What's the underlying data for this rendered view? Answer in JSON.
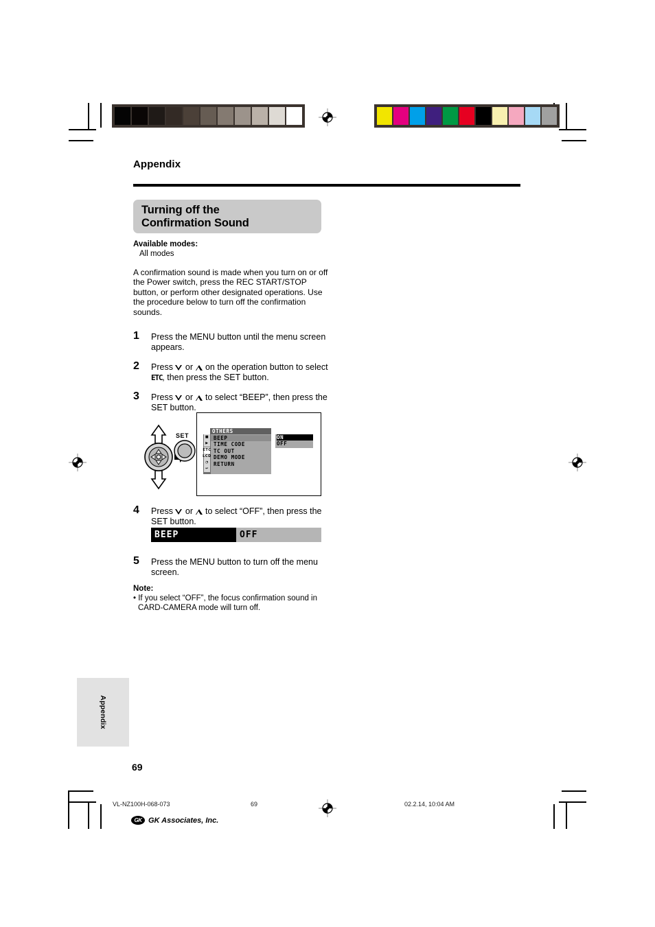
{
  "page": {
    "running_head": "Appendix",
    "heading_line1": "Turning off the",
    "heading_line2": "Confirmation Sound",
    "available_label": "Available modes:",
    "available_value": "All modes",
    "intro": "A confirmation sound is made when you turn on or off the Power switch, press the REC START/STOP button, or perform other designated operations. Use the procedure below to turn off the confirmation sounds.",
    "side_tab_label": "Appendix",
    "page_number": "69"
  },
  "steps": [
    {
      "number": "1",
      "text_parts": [
        "Press the MENU button until the menu screen appears."
      ]
    },
    {
      "number": "2",
      "pre": "Press ",
      "mid": " or ",
      "post": " on the operation button to select ",
      "osd_token": "ETC",
      "tail": ", then press the SET button."
    },
    {
      "number": "3",
      "pre": "Press ",
      "mid": " or ",
      "post": " to select “BEEP”, then press the SET button."
    },
    {
      "number": "4",
      "pre": "Press ",
      "mid": " or ",
      "post": " to select “OFF”, then press the SET button."
    },
    {
      "number": "5",
      "text_parts": [
        "Press the MENU button to turn off the menu screen."
      ]
    }
  ],
  "figure_operation_button": {
    "set_label": "SET",
    "up_arrow": "up-arrow",
    "down_arrow": "down-arrow",
    "left_arrow": "left-arrow",
    "right_arrow": "right-arrow"
  },
  "osd_menu": {
    "title": "OTHERS",
    "icons": [
      {
        "name": "camera-mode-icon",
        "glyph": "■",
        "selected": false
      },
      {
        "name": "playback-mode-icon",
        "glyph": "▶",
        "selected": false
      },
      {
        "name": "etc-mode-icon",
        "glyph": "ETC",
        "selected": true
      },
      {
        "name": "card-mode-icon",
        "glyph": "LCD",
        "selected": false
      },
      {
        "name": "clock-icon",
        "glyph": "◔",
        "selected": false
      },
      {
        "name": "return-icon",
        "glyph": "↩",
        "selected": false
      }
    ],
    "items": [
      {
        "label": "BEEP",
        "highlighted": true
      },
      {
        "label": "TIME CODE",
        "highlighted": false
      },
      {
        "label": "TC OUT",
        "highlighted": false
      },
      {
        "label": "DEMO MODE",
        "highlighted": false
      },
      {
        "label": "RETURN",
        "highlighted": false
      }
    ],
    "values": [
      {
        "label": "ON",
        "selected": true
      },
      {
        "label": "OFF",
        "selected": false
      }
    ]
  },
  "beep_bar": {
    "name": "BEEP",
    "value": "OFF"
  },
  "note": {
    "label": "Note:",
    "bullet": "•",
    "text": "If you select “OFF”, the focus confirmation sound in CARD-CAMERA mode will turn off."
  },
  "footer": {
    "file_id": "VL-NZ100H-068-073",
    "page_number": "69",
    "timestamp": "02.2.14, 10:04 AM",
    "logo_mark": "GK",
    "logo_text": "GK Associates, Inc."
  },
  "calibration": {
    "grayscale_patches": [
      "#040404",
      "#0a0605",
      "#1f1a17",
      "#332a25",
      "#4b4038",
      "#665c53",
      "#847a71",
      "#9c938b",
      "#bab1a8",
      "#dedad4",
      "#ffffff"
    ],
    "color_patches": [
      "#f2e500",
      "#e4007f",
      "#00a0e9",
      "#3f1f7e",
      "#009944",
      "#e60021",
      "#000000",
      "#f9f0b0",
      "#f5a8bf",
      "#a6d9f5",
      "#a0a0a0"
    ]
  }
}
